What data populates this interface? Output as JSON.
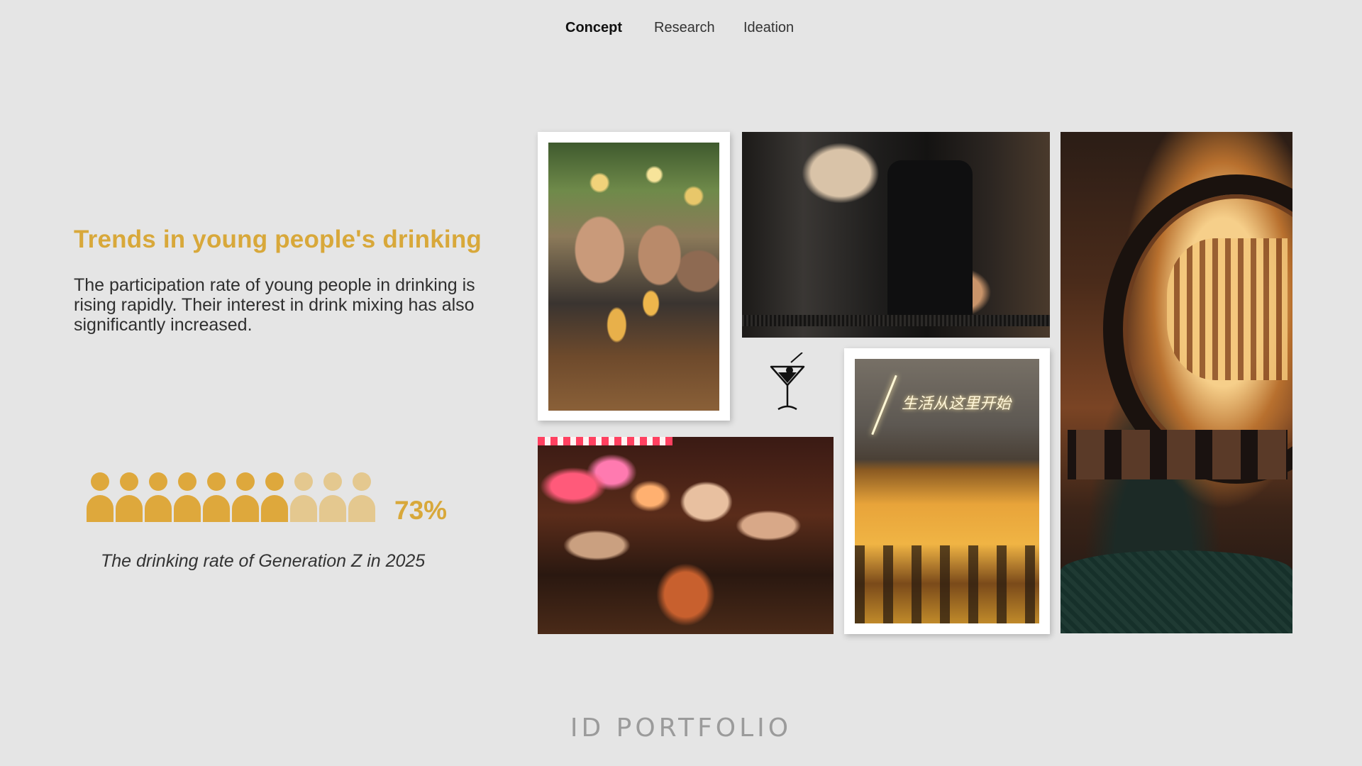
{
  "nav": {
    "items": [
      {
        "label": "Concept",
        "active": true
      },
      {
        "label": "Research",
        "active": false
      },
      {
        "label": "Ideation",
        "active": false
      }
    ]
  },
  "content": {
    "title": "Trends in young people's drinking",
    "body": "The participation rate of young people in drinking is rising rapidly. Their interest in drink mixing has also significantly increased.",
    "stat": {
      "value": "73%",
      "icons_total": 10,
      "icons_filled": 7,
      "caption": "The drinking rate of Generation Z in 2025"
    }
  },
  "images": {
    "entrance_sign_text": "生活从这里开始"
  },
  "colors": {
    "accent": "#d8a83a",
    "icon_filled": "#dea83c",
    "icon_empty": "#e4c88f",
    "background": "#e5e5e5"
  },
  "footer": {
    "text": "ID PORTFOLIO"
  }
}
